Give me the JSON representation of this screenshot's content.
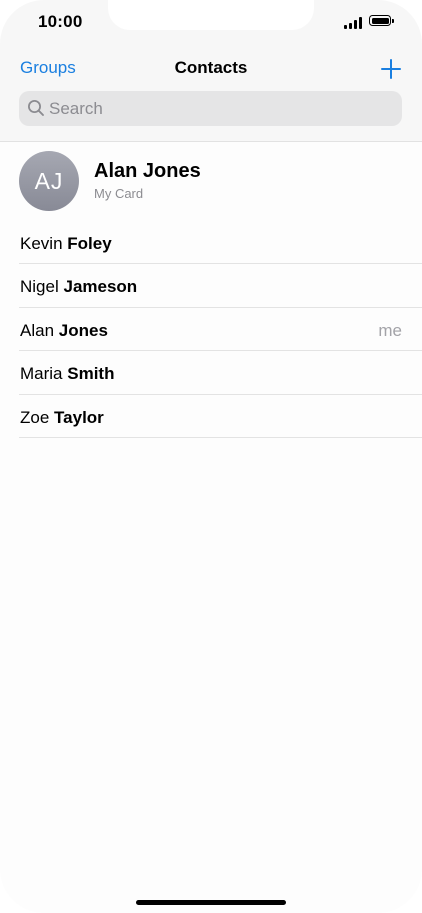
{
  "status_bar": {
    "time": "10:00"
  },
  "nav": {
    "groups_label": "Groups",
    "title": "Contacts",
    "add_icon": "plus-icon"
  },
  "search": {
    "placeholder": "Search",
    "icon": "search-icon"
  },
  "my_card": {
    "initials": "AJ",
    "name": "Alan Jones",
    "subtitle": "My Card"
  },
  "contacts": [
    {
      "first": "Kevin",
      "last": "Foley",
      "tag": ""
    },
    {
      "first": "Nigel",
      "last": "Jameson",
      "tag": ""
    },
    {
      "first": "Alan",
      "last": "Jones",
      "tag": "me"
    },
    {
      "first": "Maria",
      "last": "Smith",
      "tag": ""
    },
    {
      "first": "Zoe",
      "last": "Taylor",
      "tag": ""
    }
  ],
  "colors": {
    "accent": "#1a7fe0",
    "secondary_text": "#8c8c91"
  }
}
